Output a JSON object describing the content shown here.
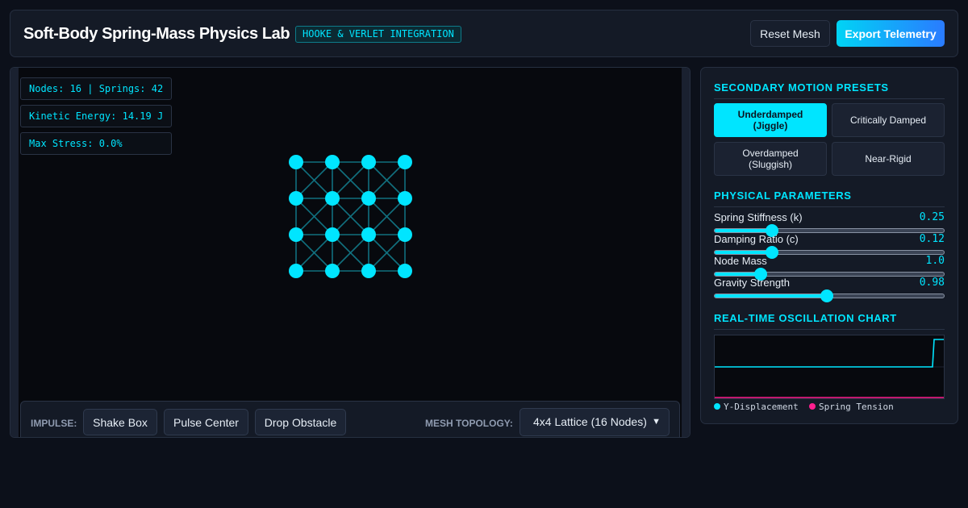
{
  "header": {
    "title": "Soft-Body Spring-Mass Physics Lab",
    "badge": "HOOKE & VERLET INTEGRATION",
    "reset_label": "Reset Mesh",
    "export_label": "Export Telemetry"
  },
  "stats": {
    "nodes_springs": "Nodes: 16 | Springs: 42",
    "kinetic_energy": "Kinetic Energy: 14.19 J",
    "max_stress": "Max Stress: 0.0%"
  },
  "mesh": {
    "rows": 4,
    "cols": 4,
    "node_color": "#00e5ff",
    "spring_color": "#11707f"
  },
  "impulse": {
    "label": "IMPULSE:",
    "buttons": [
      "Shake Box",
      "Pulse Center",
      "Drop Obstacle"
    ],
    "topology_label": "MESH TOPOLOGY:",
    "topology_selected": "4x4 Lattice (16 Nodes)"
  },
  "panel": {
    "presets_title": "SECONDARY MOTION PRESETS",
    "presets": [
      {
        "label": "Underdamped\n(Jiggle)",
        "active": true
      },
      {
        "label": "Critically Damped",
        "active": false
      },
      {
        "label": "Overdamped\n(Sluggish)",
        "active": false
      },
      {
        "label": "Near-Rigid",
        "active": false
      }
    ],
    "params_title": "PHYSICAL PARAMETERS",
    "params": [
      {
        "label": "Spring Stiffness (k)",
        "value": "0.25",
        "level": 0.25
      },
      {
        "label": "Damping Ratio (c)",
        "value": "0.12",
        "level": 0.25
      },
      {
        "label": "Node Mass",
        "value": "1.0",
        "level": 0.2
      },
      {
        "label": "Gravity Strength",
        "value": "0.98",
        "level": 0.49
      }
    ],
    "chart_title": "REAL-TIME OSCILLATION CHART",
    "legend": [
      {
        "label": "Y-Displacement",
        "color": "#00e5ff"
      },
      {
        "label": "Spring Tension",
        "color": "#ff1f8f"
      }
    ]
  },
  "colors": {
    "accent": "#00e5ff",
    "secondary": "#ff1f8f",
    "background": "#0c101a"
  }
}
